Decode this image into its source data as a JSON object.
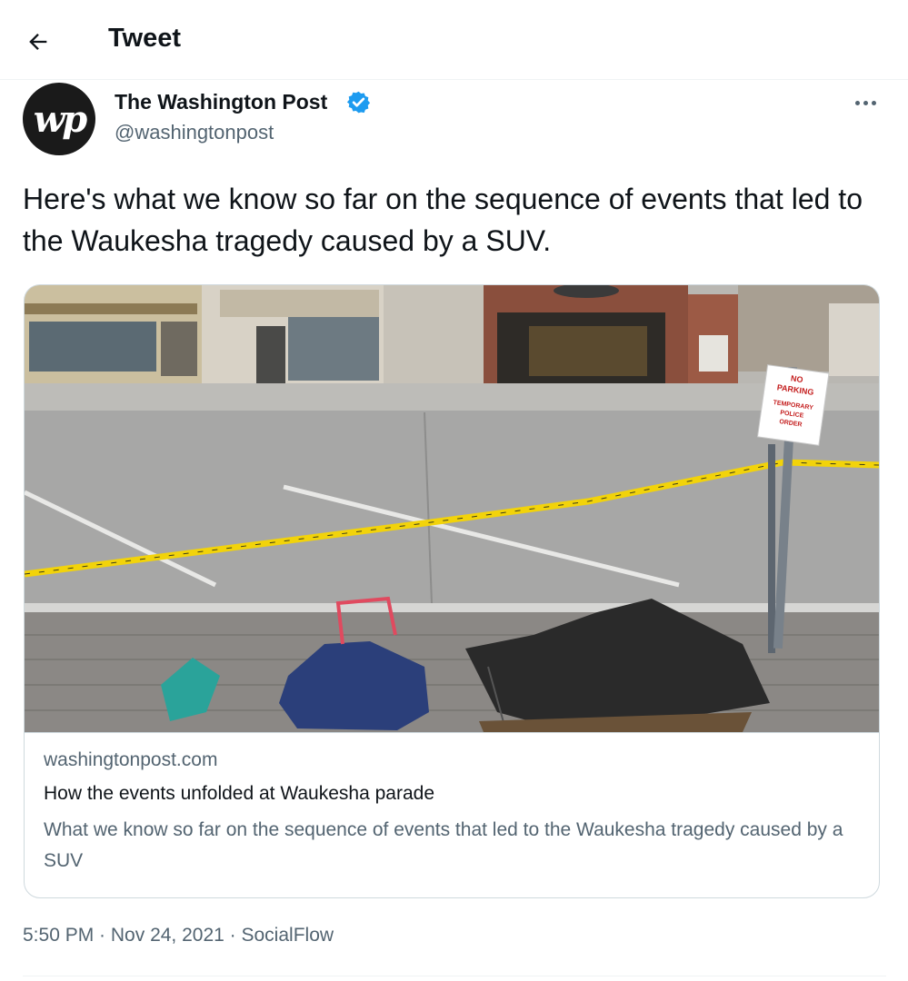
{
  "header": {
    "title": "Tweet",
    "back_icon": "arrow-left-icon"
  },
  "author": {
    "name": "The Washington Post",
    "handle": "@washingtonpost",
    "avatar_text": "wp",
    "verified": true,
    "verified_color": "#1d9bf0"
  },
  "more_icon": "more-horizontal-icon",
  "tweet": {
    "text": "Here's what we know so far on the sequence of events that led to the Waukesha tragedy caused by a SUV."
  },
  "card": {
    "domain": "washingtonpost.com",
    "title": "How the events unfolded at Waukesha parade",
    "description": "What we know so far on the sequence of events that led to the Waukesha tragedy caused by a SUV",
    "image_sign": {
      "line1": "NO",
      "line2": "PARKING",
      "line3": "TEMPORARY",
      "line4": "POLICE",
      "line5": "ORDER"
    }
  },
  "meta": {
    "time": "5:50 PM",
    "sep1": " · ",
    "date": "Nov 24, 2021",
    "sep2": " · ",
    "source": "SocialFlow"
  },
  "colors": {
    "text": "#0f1419",
    "secondary": "#536471",
    "border": "#cfd9de",
    "police_tape": "#f2d30a"
  }
}
